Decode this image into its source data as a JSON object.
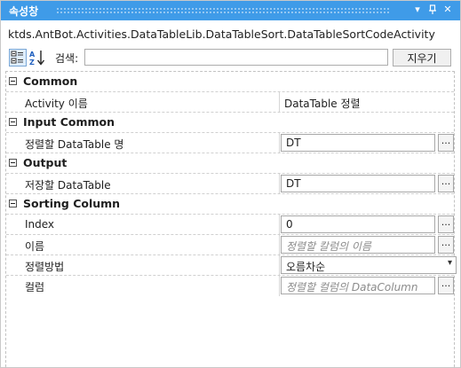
{
  "window": {
    "title": "속성창",
    "controls": {
      "dropdown": "▾",
      "pin": "ᚹ",
      "close": "✕"
    }
  },
  "type_name": "ktds.AntBot.Activities.DataTableLib.DataTableSort.DataTableSortCodeActivity",
  "toolbar": {
    "search_label": "검색:",
    "search_value": "",
    "clear_label": "지우기"
  },
  "categories": {
    "common": {
      "label": "Common",
      "props": {
        "activity_name": {
          "label": "Activity 이름",
          "value": "DataTable 정렬"
        }
      }
    },
    "input_common": {
      "label": "Input Common",
      "props": {
        "sort_table": {
          "label": "정렬할 DataTable 명",
          "value": "DT"
        }
      }
    },
    "output": {
      "label": "Output",
      "props": {
        "save_table": {
          "label": "저장할 DataTable",
          "value": "DT"
        }
      }
    },
    "sorting_column": {
      "label": "Sorting Column",
      "props": {
        "index": {
          "label": "Index",
          "value": "0"
        },
        "name": {
          "label": "이름",
          "placeholder": "정렬할 칼럼의 이름"
        },
        "sort_method": {
          "label": "정렬방법",
          "value": "오름차순"
        },
        "column": {
          "label": "컬럼",
          "placeholder": "정렬할 컬럼의 DataColumn"
        }
      }
    }
  },
  "ellipsis_label": "...",
  "colors": {
    "titlebar": "#3f9be8",
    "placeholder": "#8c8c8c"
  }
}
